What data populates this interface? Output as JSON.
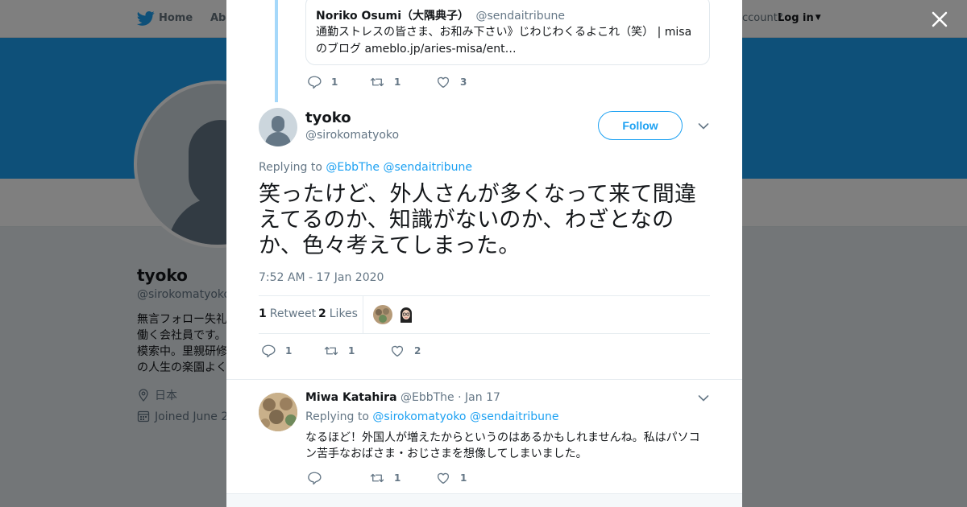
{
  "colors": {
    "accent": "#1da1f2",
    "text_primary": "#14171a",
    "text_secondary": "#657786",
    "banner": "#1da1f2",
    "thread_line": "#a5d8fa"
  },
  "background_page": {
    "nav": {
      "home_label": "Home",
      "about_label": "Abo",
      "account_prompt": "ccount?",
      "login_label": "Log in"
    },
    "profile": {
      "name": "tyoko",
      "handle": "@sirokomatyoko",
      "bio": [
        "無言フォロー失礼",
        "働く会社員です。",
        "模索中。里親研修",
        "の人生の楽園よく"
      ],
      "location": "日本",
      "joined": "Joined June 2"
    }
  },
  "modal": {
    "quoted_tweet": {
      "name": "Noriko Osumi（大隅典子）",
      "handle": "@sendaitribune",
      "text": "通勤ストレスの皆さま、お和み下さい》じわじわくるよこれ（笑） | misaのブログ ameblo.jp/aries-misa/ent…"
    },
    "parent_actions": {
      "replies": "1",
      "retweets": "1",
      "likes": "3"
    },
    "main_tweet": {
      "name": "tyoko",
      "handle": "@sirokomatyoko",
      "follow_label": "Follow",
      "replying_prefix": "Replying to",
      "replying_to": [
        "@EbbThe",
        "@sendaitribune"
      ],
      "text": "笑ったけど、外人さんが多くなって来て間違えてるのか、知識がないのか、わざとなのか、色々考えてしまった。",
      "timestamp": "7:52 AM - 17 Jan 2020",
      "stats": {
        "retweet_count": "1",
        "retweet_label": "Retweet",
        "like_count": "2",
        "like_label": "Likes"
      },
      "actions": {
        "replies": "1",
        "retweets": "1",
        "likes": "2"
      }
    },
    "reply_tweet": {
      "name": "Miwa Katahira",
      "handle": "@EbbThe",
      "separator": "·",
      "date": "Jan 17",
      "replying_prefix": "Replying to",
      "replying_to": [
        "@sirokomatyoko",
        "@sendaitribune"
      ],
      "text": "なるほど！外国人が増えたからというのはあるかもしれませんね。私はパソコン苦手なおばさま・おじさまを想像してしまいました。",
      "actions": {
        "replies": "",
        "retweets": "1",
        "likes": "1"
      }
    }
  }
}
